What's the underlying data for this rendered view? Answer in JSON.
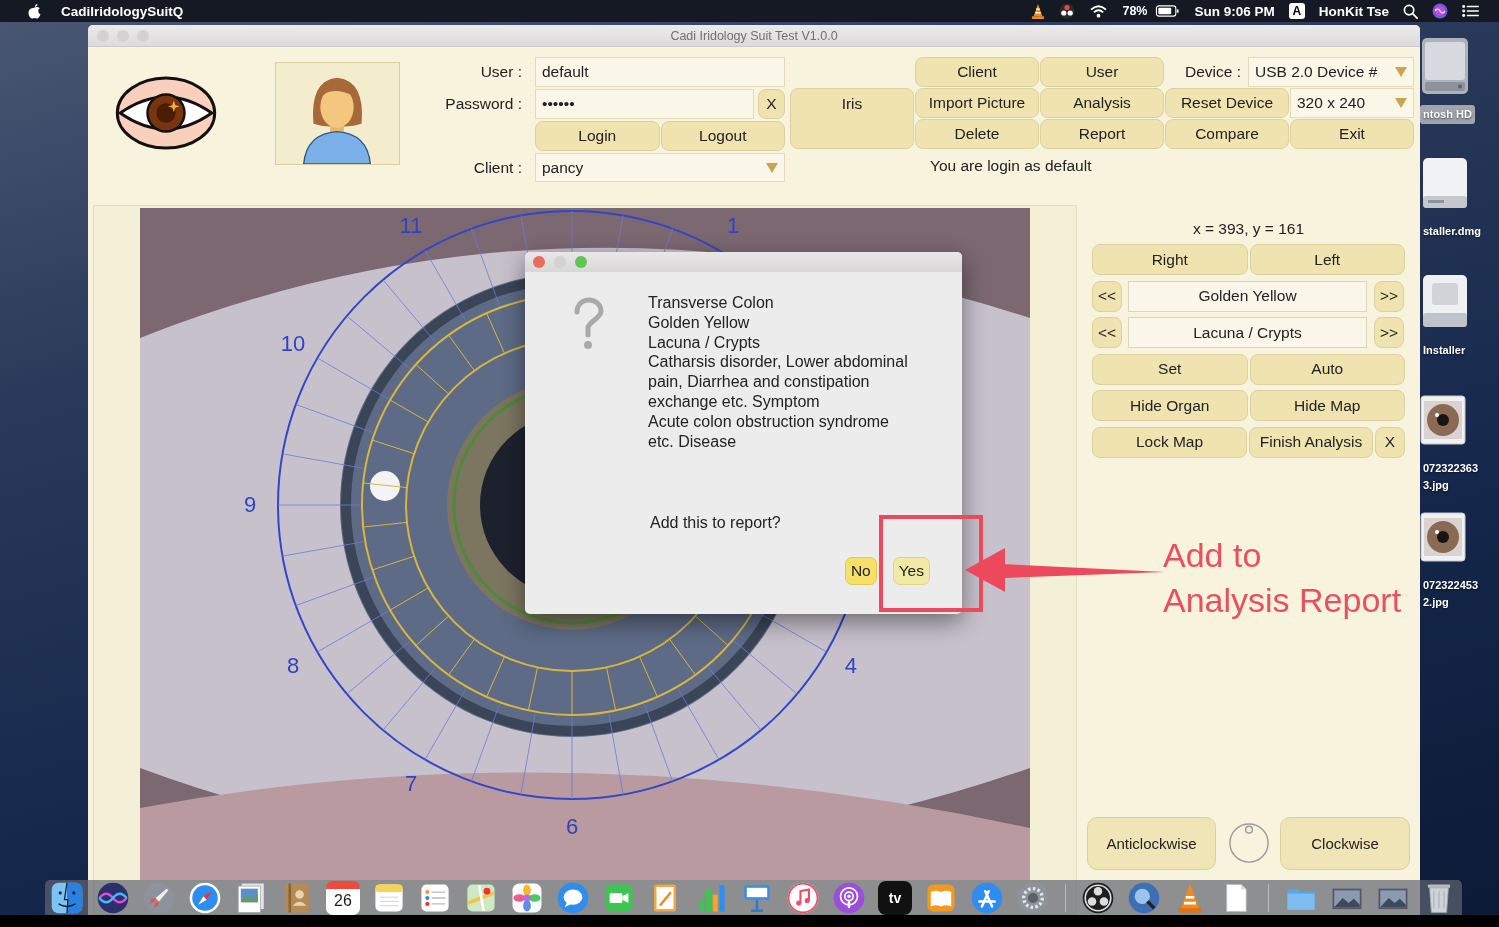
{
  "menu_bar": {
    "app_name": "CadiIridologySuitQ",
    "battery": "78%",
    "clock": "Sun 9:06 PM",
    "input_source": "A",
    "user": "HonKit Tse"
  },
  "window": {
    "title": "Cadi Iridology Suit Test V1.0.0",
    "active": false
  },
  "login": {
    "user_label": "User :",
    "user_value": "default",
    "password_label": "Password :",
    "password_value": "••••••",
    "clear_button": "X",
    "login_button": "Login",
    "logout_button": "Logout",
    "client_label": "Client :",
    "client_value": "pancy"
  },
  "toolbar": {
    "iris_button": "Iris",
    "items": [
      {
        "kind": "button",
        "label": "Client"
      },
      {
        "kind": "button",
        "label": "User"
      },
      {
        "kind": "label",
        "label": "Device :"
      },
      {
        "kind": "dropdown",
        "label": "USB 2.0 Device #"
      },
      {
        "kind": "button",
        "label": "Import Picture"
      },
      {
        "kind": "button",
        "label": "Analysis"
      },
      {
        "kind": "button",
        "label": "Reset Device"
      },
      {
        "kind": "dropdown",
        "label": "320 x 240"
      },
      {
        "kind": "button",
        "label": "Delete"
      },
      {
        "kind": "button",
        "label": "Report"
      },
      {
        "kind": "button",
        "label": "Compare"
      },
      {
        "kind": "button",
        "label": "Exit"
      }
    ],
    "status": "You are login as default"
  },
  "iris_view": {
    "clock_labels": [
      "11",
      "1",
      "10",
      "9",
      "8",
      "4",
      "7",
      "6"
    ]
  },
  "dialog": {
    "active": true,
    "details": [
      "Transverse Colon",
      "Golden Yellow",
      "Lacuna / Crypts",
      "Catharsis disorder, Lower abdominal pain, Diarrhea and constipation exchange etc. Symptom",
      "Acute colon obstruction syndrome etc. Disease"
    ],
    "question": "Add this to report?",
    "buttons": [
      {
        "label": "No",
        "hovered": true
      },
      {
        "label": "Yes",
        "hovered": false
      }
    ]
  },
  "callout": {
    "text": "Add to\nAnalysis Report"
  },
  "analysis_panel": {
    "coordinates": "x = 393, y = 161",
    "rows": [
      {
        "kind": "pair",
        "buttons": [
          "Right",
          "Left"
        ]
      },
      {
        "kind": "stepper",
        "prev": "<<",
        "value": "Golden Yellow",
        "next": ">>"
      },
      {
        "kind": "stepper",
        "prev": "<<",
        "value": "Lacuna / Crypts",
        "next": ">>"
      },
      {
        "kind": "pair",
        "buttons": [
          "Set",
          "Auto"
        ]
      },
      {
        "kind": "pair",
        "buttons": [
          "Hide Organ",
          "Hide Map"
        ]
      },
      {
        "kind": "pair",
        "buttons": [
          "Lock Map",
          "Finish Analysis"
        ],
        "close": "X"
      }
    ],
    "rotate_left": "Anticlockwise",
    "rotate_right": "Clockwise"
  },
  "desktop_icons": [
    {
      "kind": "drive",
      "label": "ntosh HD",
      "selected": true
    },
    {
      "kind": "disk_image",
      "label": "staller.dmg",
      "selected": false
    },
    {
      "kind": "installer",
      "label": "Installer",
      "selected": false
    },
    {
      "kind": "photo",
      "label": "072322363\n3.jpg",
      "selected": false
    },
    {
      "kind": "photo",
      "label": "072322453\n2.jpg",
      "selected": false
    }
  ],
  "dock": [
    {
      "kind": "finder"
    },
    {
      "kind": "siri"
    },
    {
      "kind": "launchpad"
    },
    {
      "kind": "safari"
    },
    {
      "kind": "preview"
    },
    {
      "kind": "contacts"
    },
    {
      "kind": "calendar",
      "text": "26"
    },
    {
      "kind": "notes"
    },
    {
      "kind": "reminders"
    },
    {
      "kind": "maps"
    },
    {
      "kind": "photos"
    },
    {
      "kind": "messages"
    },
    {
      "kind": "facetime"
    },
    {
      "kind": "pages"
    },
    {
      "kind": "numbers"
    },
    {
      "kind": "keynote"
    },
    {
      "kind": "music"
    },
    {
      "kind": "podcasts"
    },
    {
      "kind": "tv",
      "text": "tv"
    },
    {
      "kind": "books"
    },
    {
      "kind": "appstore"
    },
    {
      "kind": "settings"
    },
    {
      "kind": "separator"
    },
    {
      "kind": "obs"
    },
    {
      "kind": "quicktime"
    },
    {
      "kind": "vlc"
    },
    {
      "kind": "document"
    },
    {
      "kind": "separator"
    },
    {
      "kind": "folder"
    },
    {
      "kind": "image"
    },
    {
      "kind": "image"
    },
    {
      "kind": "trash"
    }
  ]
}
